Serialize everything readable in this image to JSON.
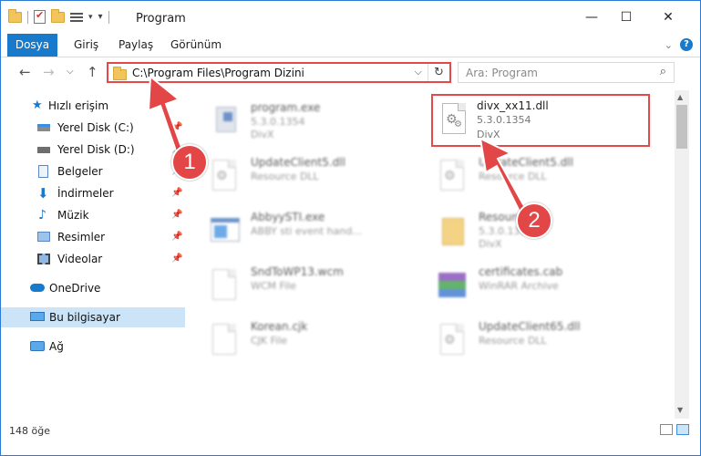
{
  "window": {
    "title": "Program",
    "controls": {
      "minimize": "—",
      "maximize": "☐",
      "close": "✕"
    }
  },
  "ribbon": {
    "tabs": [
      {
        "label": "Dosya",
        "active": true
      },
      {
        "label": "Giriş"
      },
      {
        "label": "Paylaş"
      },
      {
        "label": "Görünüm"
      }
    ],
    "expand_icon": "chevron-down-icon",
    "help": "?"
  },
  "address_bar": {
    "path": "C:\\Program Files\\Program Dizini",
    "dropdown": "⌵",
    "refresh": "↻"
  },
  "search": {
    "placeholder": "Ara: Program",
    "icon": "⌕"
  },
  "nav_buttons": {
    "back": "←",
    "forward": "→",
    "recent": "⌵",
    "up": "↑"
  },
  "nav_pane": [
    {
      "label": "Hızlı erişim",
      "icon": "star-icon",
      "pinned": false
    },
    {
      "label": "Yerel Disk (C:)",
      "icon": "drive-icon",
      "pinned": true
    },
    {
      "label": "Yerel Disk (D:)",
      "icon": "drive-icon",
      "pinned": true
    },
    {
      "label": "Belgeler",
      "icon": "documents-icon",
      "pinned": true
    },
    {
      "label": "İndirmeler",
      "icon": "download-icon",
      "pinned": true
    },
    {
      "label": "Müzik",
      "icon": "music-icon",
      "pinned": true
    },
    {
      "label": "Resimler",
      "icon": "pictures-icon",
      "pinned": true
    },
    {
      "label": "Videolar",
      "icon": "videos-icon",
      "pinned": true
    },
    {
      "label": "OneDrive",
      "icon": "cloud-icon",
      "pinned": false
    },
    {
      "label": "Bu bilgisayar",
      "icon": "computer-icon",
      "pinned": false,
      "selected": true
    },
    {
      "label": "Ağ",
      "icon": "network-icon",
      "pinned": false
    }
  ],
  "files": [
    {
      "name": "program.exe",
      "line2": "5.3.0.1354",
      "line3": "DivX",
      "icon": "exe-icon",
      "highlight": false
    },
    {
      "name": "divx_xx11.dll",
      "line2": "5.3.0.1354",
      "line3": "DivX",
      "icon": "dll-icon",
      "highlight": true
    },
    {
      "name": "UpdateClient5.dll",
      "line2": "Resource DLL",
      "line3": "",
      "icon": "dll-icon",
      "highlight": false
    },
    {
      "name": "UpdateClient5.dll",
      "line2": "Resource DLL",
      "line3": "",
      "icon": "dll-icon",
      "highlight": false
    },
    {
      "name": "AbbyySTI.exe",
      "line2": "ABBY sti event hand...",
      "line3": "",
      "icon": "exe-window-icon",
      "highlight": false
    },
    {
      "name": "Resource",
      "line2": "5.3.0.1354",
      "line3": "DivX",
      "icon": "archive-icon",
      "highlight": false
    },
    {
      "name": "SndToWP13.wcm",
      "line2": "WCM File",
      "line3": "",
      "icon": "doc-icon",
      "highlight": false
    },
    {
      "name": "certificates.cab",
      "line2": "WinRAR Archive",
      "line3": "",
      "icon": "winrar-icon",
      "highlight": false
    },
    {
      "name": "Korean.cjk",
      "line2": "CJK File",
      "line3": "",
      "icon": "doc-icon",
      "highlight": false
    },
    {
      "name": "UpdateClient65.dll",
      "line2": "Resource DLL",
      "line3": "",
      "icon": "dll-icon",
      "highlight": false
    }
  ],
  "status": {
    "count": "148 öğe"
  },
  "callouts": [
    {
      "label": "1"
    },
    {
      "label": "2"
    }
  ],
  "colors": {
    "accent": "#1979ca",
    "highlight": "#e54848",
    "selected": "#cce4f7"
  }
}
